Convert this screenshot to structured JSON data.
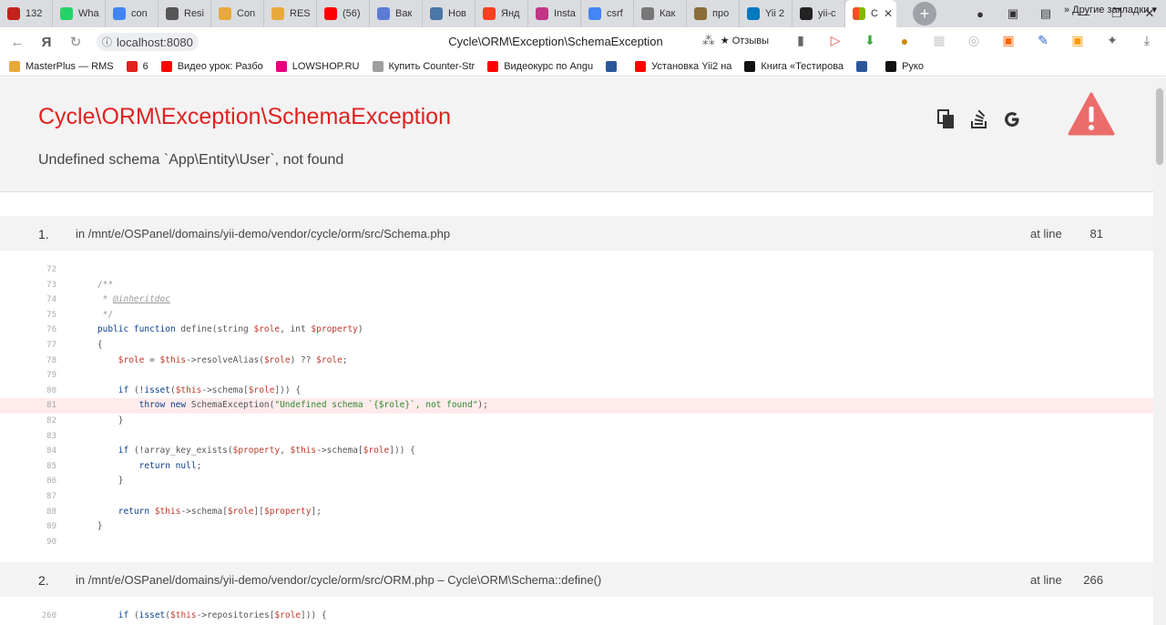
{
  "tabs": [
    {
      "label": "132",
      "color": "#c5221f"
    },
    {
      "label": "Wha",
      "color": "#25d366"
    },
    {
      "label": "con",
      "color": "#4285f4"
    },
    {
      "label": "Resi",
      "color": "#555555"
    },
    {
      "label": "Con",
      "color": "#e8a93b"
    },
    {
      "label": "RES",
      "color": "#e8a93b"
    },
    {
      "label": "(56)",
      "color": "#ff0000"
    },
    {
      "label": "Вак",
      "color": "#5b7bd5"
    },
    {
      "label": "Нов",
      "color": "#4a76a8"
    },
    {
      "label": "Янд",
      "color": "#fc3f1d"
    },
    {
      "label": "Insta",
      "color": "#c13584"
    },
    {
      "label": "csrf",
      "color": "#4285f4"
    },
    {
      "label": "Как",
      "color": "#777777"
    },
    {
      "label": "про",
      "color": "#8a6d3b"
    },
    {
      "label": "Yii 2",
      "color": "#0079bf"
    },
    {
      "label": "yii-c",
      "color": "#222222"
    }
  ],
  "active_tab": {
    "label": "C",
    "close": "✕"
  },
  "address": {
    "url": "localhost:8080",
    "title": "Cycle\\ORM\\Exception\\SchemaException",
    "feedback": "★ Отзывы"
  },
  "bookmarks": [
    {
      "label": "MasterPlus — RMS",
      "color": "#e8a93b"
    },
    {
      "label": "6",
      "color": "#e0211f"
    },
    {
      "label": "Видео урок: Разбо",
      "color": "#ff0000"
    },
    {
      "label": "LOWSHOP.RU",
      "color": "#e6007e"
    },
    {
      "label": "Купить Counter-Str",
      "color": "#9e9e9e"
    },
    {
      "label": "Видеокурс по Angu",
      "color": "#ff0000"
    },
    {
      "label": "",
      "color": "#2b579a"
    },
    {
      "label": "Установка Yii2 на",
      "color": "#ff0000"
    },
    {
      "label": "Книга «Тестирова",
      "color": "#111111"
    },
    {
      "label": "",
      "color": "#2b579a"
    },
    {
      "label": "Руко",
      "color": "#111111"
    }
  ],
  "bookmarks_more": "»  Другие закладки ▾",
  "error": {
    "title": "Cycle\\ORM\\Exception\\SchemaException",
    "message": "Undefined schema `App\\Entity\\User`, not found"
  },
  "frames": [
    {
      "num": "1.",
      "path": "in /mnt/e/OSPanel/domains/yii-demo/vendor/cycle/orm/src/Schema.php",
      "at_line_label": "at line",
      "line": "81"
    },
    {
      "num": "2.",
      "path": "in /mnt/e/OSPanel/domains/yii-demo/vendor/cycle/orm/src/ORM.php – Cycle\\ORM\\Schema::define()",
      "at_line_label": "at line",
      "line": "266"
    }
  ],
  "code1": {
    "ln": [
      "72",
      "73",
      "74",
      "75",
      "76",
      "77",
      "78",
      "79",
      "80",
      "81",
      "82",
      "83",
      "84",
      "85",
      "86",
      "87",
      "88",
      "89",
      "90"
    ]
  },
  "code2": {
    "ln": [
      "260"
    ]
  }
}
